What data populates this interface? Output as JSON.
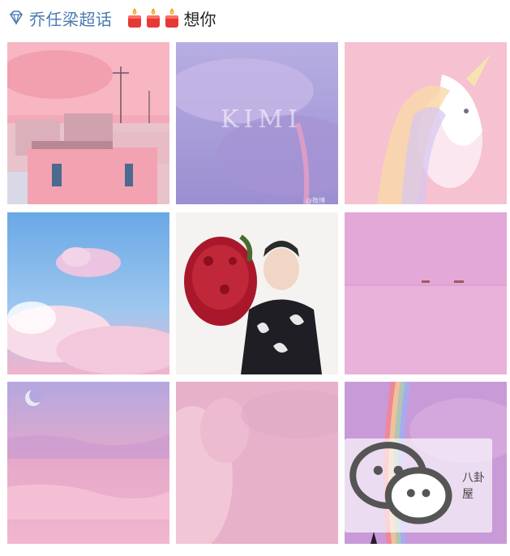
{
  "header": {
    "topic_icon": "supertopic-diamond-icon",
    "topic_label": "乔任梁超话",
    "emoji": [
      "candle-icon",
      "candle-icon",
      "candle-icon"
    ],
    "post_text": "想你"
  },
  "grid": {
    "tiles": [
      {
        "name": "photo-pink-city-rooftops",
        "icon": "city-buildings"
      },
      {
        "name": "photo-kimi-clouds",
        "icon": "clouds-rainbow",
        "text": "KIMI",
        "mark": "@微博 N..."
      },
      {
        "name": "photo-unicorn",
        "icon": "unicorn"
      },
      {
        "name": "photo-blue-sky-clouds",
        "icon": "clouds"
      },
      {
        "name": "photo-man-with-roses",
        "icon": "person-with-roses"
      },
      {
        "name": "photo-pink-sea-boats",
        "icon": "sea-boats"
      },
      {
        "name": "photo-moon-pink-sky",
        "icon": "moon-sky"
      },
      {
        "name": "photo-pink-clouds",
        "icon": "clouds"
      },
      {
        "name": "photo-rainbow-purple-sky",
        "icon": "rainbow"
      }
    ]
  },
  "watermark": {
    "icon": "wechat-icon",
    "text": "八卦屋"
  }
}
